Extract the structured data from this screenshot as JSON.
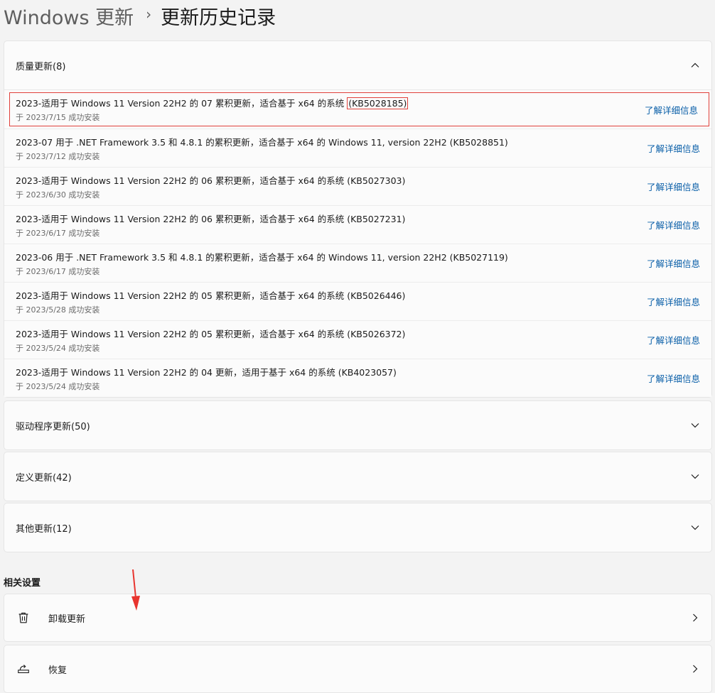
{
  "breadcrumb": {
    "parent": "Windows 更新",
    "separator": "›",
    "title": "更新历史记录"
  },
  "quality": {
    "title": "质量更新(8)",
    "expanded": true,
    "items": [
      {
        "title_pre": "2023-适用于 Windows 11 Version 22H2 的 07 累积更新，适合基于 x64 的系统 ",
        "kb": "(KB5028185)",
        "sub": "于 2023/7/15 成功安装",
        "link": "了解详细信息"
      },
      {
        "title": "2023-07 用于 .NET Framework 3.5 和 4.8.1 的累积更新，适合基于 x64 的 Windows 11, version 22H2 (KB5028851)",
        "sub": "于 2023/7/12 成功安装",
        "link": "了解详细信息"
      },
      {
        "title": "2023-适用于 Windows 11 Version 22H2 的 06 累积更新，适合基于 x64 的系统 (KB5027303)",
        "sub": "于 2023/6/30 成功安装",
        "link": "了解详细信息"
      },
      {
        "title": "2023-适用于 Windows 11 Version 22H2 的 06 累积更新，适合基于 x64 的系统 (KB5027231)",
        "sub": "于 2023/6/17 成功安装",
        "link": "了解详细信息"
      },
      {
        "title": "2023-06 用于 .NET Framework 3.5 和 4.8.1 的累积更新，适合基于 x64 的 Windows 11, version 22H2 (KB5027119)",
        "sub": "于 2023/6/17 成功安装",
        "link": "了解详细信息"
      },
      {
        "title": "2023-适用于 Windows 11 Version 22H2 的 05 累积更新，适合基于 x64 的系统 (KB5026446)",
        "sub": "于 2023/5/28 成功安装",
        "link": "了解详细信息"
      },
      {
        "title": "2023-适用于 Windows 11 Version 22H2 的 05 累积更新，适合基于 x64 的系统 (KB5026372)",
        "sub": "于 2023/5/24 成功安装",
        "link": "了解详细信息"
      },
      {
        "title": "2023-适用于 Windows 11 Version 22H2 的 04 更新，适用于基于 x64 的系统 (KB4023057)",
        "sub": "于 2023/5/24 成功安装",
        "link": "了解详细信息"
      }
    ]
  },
  "driver": {
    "title": "驱动程序更新(50)"
  },
  "definition": {
    "title": "定义更新(42)"
  },
  "other": {
    "title": "其他更新(12)"
  },
  "related": {
    "label": "相关设置",
    "uninstall": {
      "label": "卸载更新",
      "icon": "trash-icon"
    },
    "recovery": {
      "label": "恢复",
      "icon": "recovery-icon"
    }
  },
  "colors": {
    "link": "#0a5fa8",
    "highlight": "#e0403a",
    "annotation_arrow": "#e8352f"
  }
}
